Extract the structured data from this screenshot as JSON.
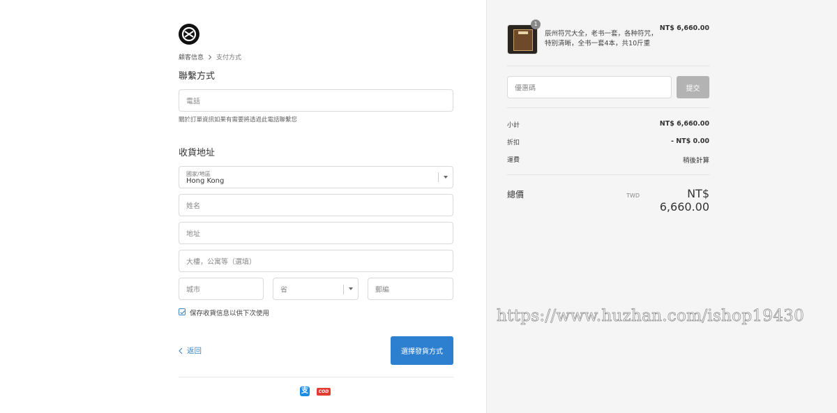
{
  "breadcrumb": {
    "step1": "顧客信息",
    "step2": "支付方式"
  },
  "contact": {
    "heading": "聯繫方式",
    "phone_placeholder": "電話",
    "hint": "關於訂單資訊如果有需要將透過此電話聯繫您"
  },
  "shipping": {
    "heading": "收貨地址",
    "country_label": "國家/地區",
    "country_value": "Hong Kong",
    "name_placeholder": "姓名",
    "address_placeholder": "地址",
    "address2_placeholder": "大樓，公寓等（選填）",
    "city_placeholder": "城市",
    "province_placeholder": "省",
    "postal_placeholder": "郵編",
    "save_info_label": "保存收貨信息以供下次使用",
    "save_info_checked": true
  },
  "actions": {
    "back_label": "返回",
    "continue_label": "選擇發貨方式"
  },
  "payments": {
    "alipay_glyph": "支",
    "cod_label": "COD"
  },
  "order": {
    "item": {
      "qty": "1",
      "name": "辰州符咒大全，老书一套，各种符咒，特别清晰，全书一套4本，共10斤重",
      "price": "NT$ 6,660.00"
    },
    "coupon_placeholder": "優惠碼",
    "coupon_submit": "提交",
    "subtotal_label": "小計",
    "subtotal_value": "NT$ 6,660.00",
    "discount_label": "折扣",
    "discount_value": "- NT$ 0.00",
    "shipping_label": "運費",
    "shipping_value": "稍後計算",
    "total_label": "總價",
    "total_currency": "TWD",
    "total_value": "NT$ 6,660.00"
  },
  "watermark": "https://www.huzhan.com/ishop19430",
  "colors": {
    "accent": "#2d7fd0",
    "link": "#3c86c8",
    "sidebar_bg": "#f5f5f5",
    "submit_disabled": "#b3b3b3"
  }
}
